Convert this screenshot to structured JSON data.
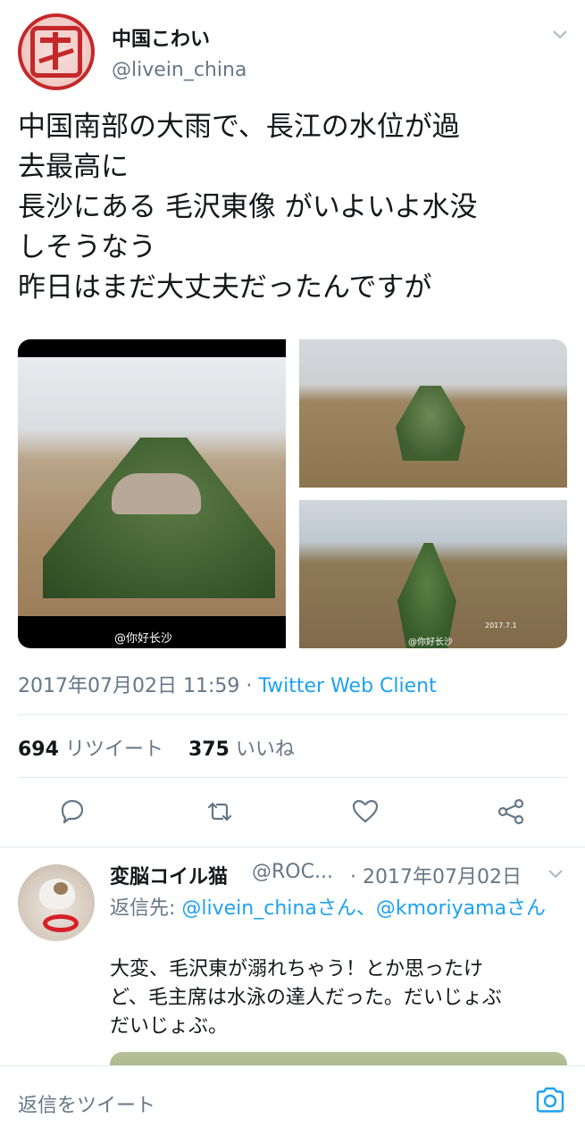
{
  "tweet": {
    "display_name": "中国こわい",
    "handle": "@livein_china",
    "text_lines": [
      "中国南部の大雨で、長江の水位が過",
      "去最高に",
      "長沙にある 毛沢東像 がいよいよ水没",
      "しそうなう",
      "昨日はまだ大丈夫だったんですが"
    ],
    "media": {
      "image1_watermark": "@你好长沙",
      "image3_watermark": "@你好长沙",
      "image3_date": "2017.7.1"
    },
    "timestamp": "2017年07月02日 11:59",
    "separator": " · ",
    "client": "Twitter Web Client",
    "retweets_count": "694",
    "retweets_label": "リツイート",
    "likes_count": "375",
    "likes_label": "いいね"
  },
  "actions": {
    "reply_icon": "speech-bubble",
    "retweet_icon": "retweet-arrows",
    "like_icon": "heart",
    "share_icon": "share-nodes"
  },
  "reply": {
    "display_name": "変脳コイル猫",
    "handle": "@ROC...",
    "time": "· 2017年07月02日",
    "reply_to_prefix": "返信先: ",
    "mention1": "@livein_chinaさん",
    "sep": "、",
    "mention2": "@kmoriyamaさん",
    "text_lines": [
      "大変、毛沢東が溺れちゃう！とか思ったけ",
      "ど、毛主席は水泳の達人だった。だいじょぶ",
      "だいじょぶ。"
    ]
  },
  "composer": {
    "placeholder": "返信をツイート",
    "camera_icon": "camera"
  },
  "colors": {
    "accent": "#1da1f2",
    "secondary_text": "#657786",
    "primary_text": "#14171a",
    "divider": "#e1e8ed",
    "avatar_red": "#c4282a"
  }
}
